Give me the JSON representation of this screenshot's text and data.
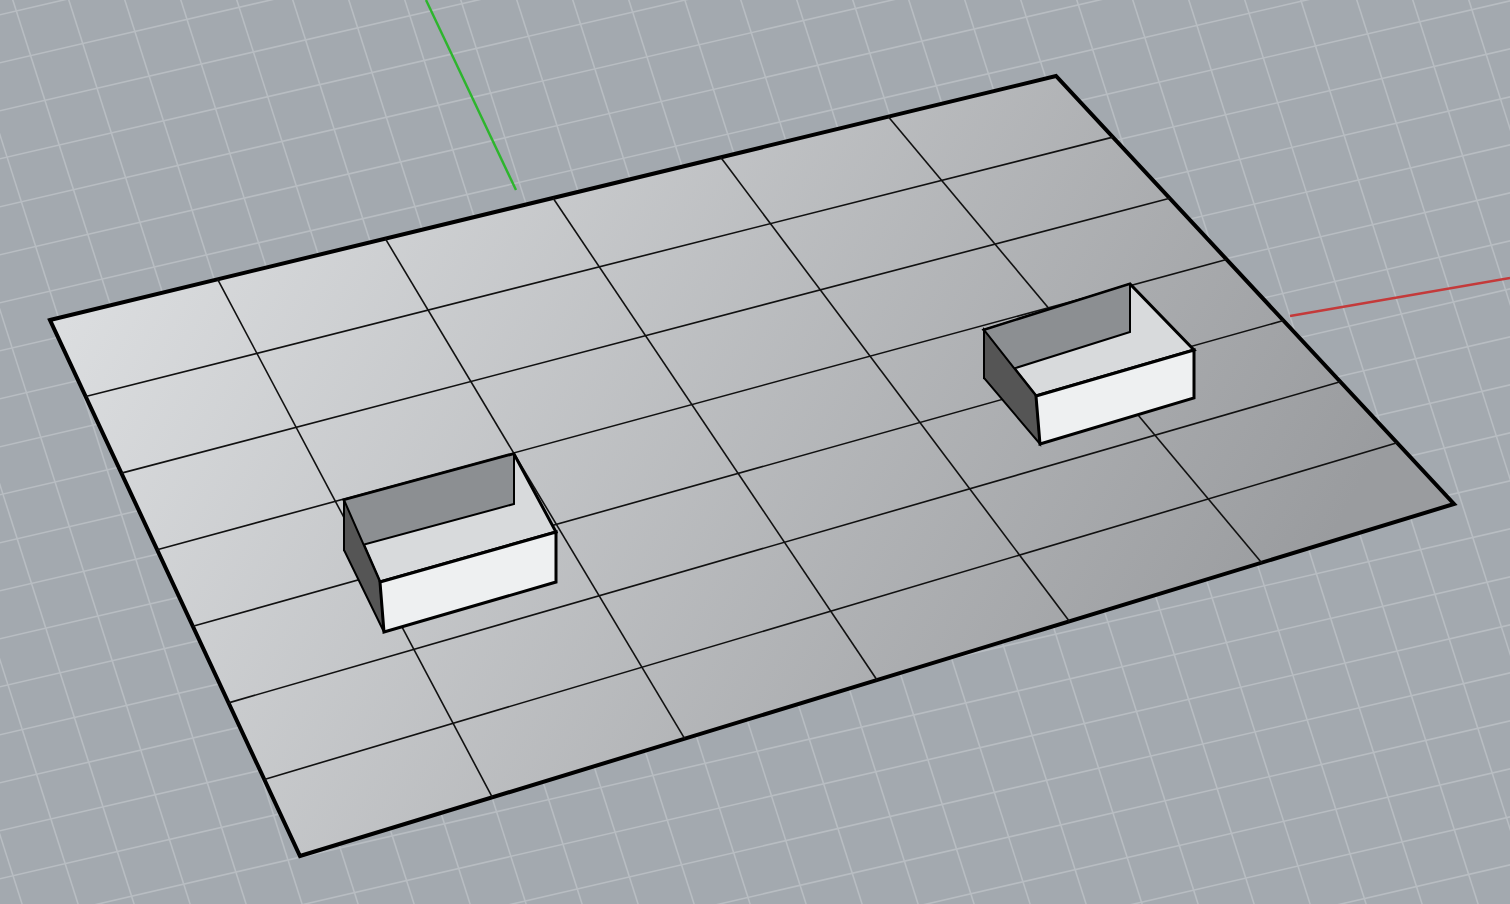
{
  "scene": {
    "objects": [
      {
        "kind": "plate"
      },
      {
        "kind": "hole"
      },
      {
        "kind": "hole"
      }
    ]
  }
}
